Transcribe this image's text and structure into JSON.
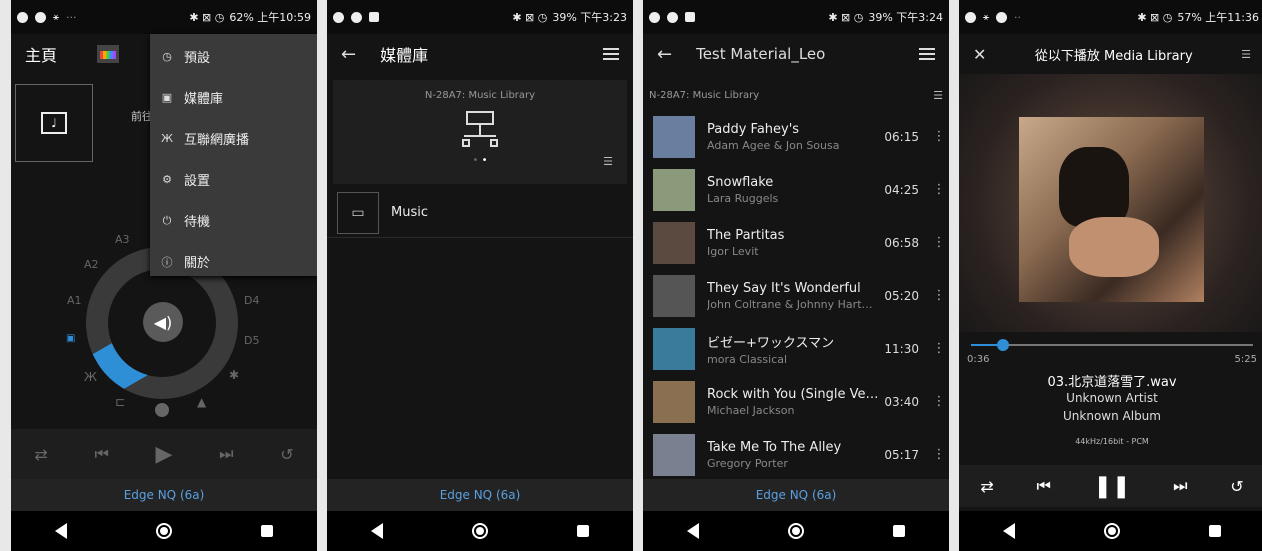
{
  "p1": {
    "status_right": "62% 上午10:59",
    "title": "主頁",
    "partial_text": "前往",
    "menu": [
      "預設",
      "媒體庫",
      "互聯網廣播",
      "設置",
      "待機",
      "關於"
    ],
    "ring_labels": {
      "a1": "A1",
      "a2": "A2",
      "a3": "A3",
      "d4": "D4",
      "d5": "D5"
    },
    "device": "Edge NQ (6a)"
  },
  "p2": {
    "status_right": "39% 下午3:23",
    "title": "媒體庫",
    "server": "N-28A7: Music Library",
    "folder": "Music",
    "device": "Edge NQ (6a)"
  },
  "p3": {
    "status_right": "39% 下午3:24",
    "title": "Test Material_Leo",
    "source": "N-28A7: Music Library",
    "device": "Edge NQ (6a)",
    "tracks": [
      {
        "title": "Paddy Fahey's",
        "artist": "Adam Agee & Jon Sousa",
        "duration": "06:15",
        "color": "#6a7fa0"
      },
      {
        "title": "Snowflake",
        "artist": "Lara Ruggels",
        "duration": "04:25",
        "color": "#8a9a7a"
      },
      {
        "title": "The Partitas",
        "artist": "Igor Levit",
        "duration": "06:58",
        "color": "#5a4a40"
      },
      {
        "title": "They Say It's Wonderful",
        "artist": "John Coltrane & Johnny Hartman",
        "duration": "05:20",
        "color": "#555"
      },
      {
        "title": "ビゼー+ワックスマン",
        "artist": "mora Classical",
        "duration": "11:30",
        "color": "#3a7a9a"
      },
      {
        "title": "Rock with You (Single Version)",
        "artist": "Michael Jackson",
        "duration": "03:40",
        "color": "#8a7050"
      },
      {
        "title": "Take Me To The Alley",
        "artist": "Gregory Porter",
        "duration": "05:17",
        "color": "#7a8090"
      }
    ]
  },
  "p4": {
    "status_right": "57% 上午11:36",
    "title": "從以下播放 Media Library",
    "elapsed": "0:36",
    "total": "5:25",
    "progress": 0.115,
    "track": "03.北京道落雪了.wav",
    "artist": "Unknown Artist",
    "album": "Unknown Album",
    "format": "44kHz/16bit - PCM"
  }
}
